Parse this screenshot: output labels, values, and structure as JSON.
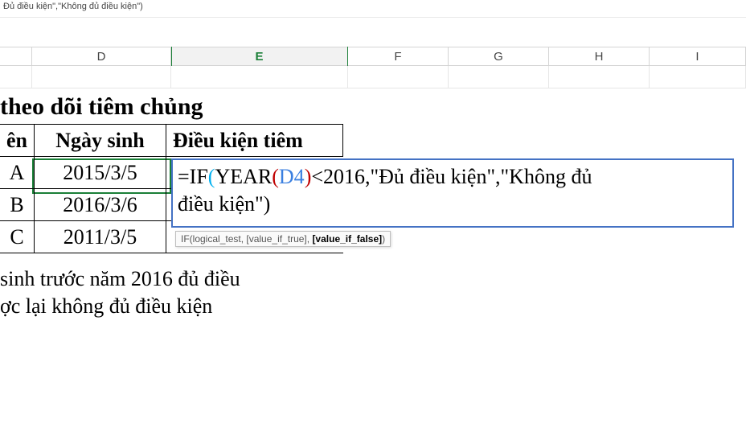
{
  "formula_bar": "Đủ điều kiện\",\"Không đủ điều kiện\")",
  "columns": {
    "D": "D",
    "E": "E",
    "F": "F",
    "G": "G",
    "H": "H",
    "I": "I"
  },
  "table": {
    "title_fragment": "theo dõi tiêm chủng",
    "headers": {
      "ten_suffix": "ên",
      "ngay_sinh": "Ngày sinh",
      "dieu_kien": "Điều kiện tiêm"
    },
    "rows": [
      {
        "ten": "A",
        "ngay_sinh": "2015/3/5"
      },
      {
        "ten": "B",
        "ngay_sinh": "2016/3/6"
      },
      {
        "ten": "C",
        "ngay_sinh": "2011/3/5"
      }
    ]
  },
  "edit": {
    "prefix": "=IF",
    "open1": "(",
    "year": "YEAR",
    "open2": "(",
    "ref": "D4",
    "close2": ")",
    "cond": "<2016,\"Đủ điều kiện\",\"Không đủ",
    "line2": "điều kiện\")"
  },
  "tooltip": {
    "fn": "IF(",
    "arg1": "logical_test",
    "arg2": ", [value_if_true], ",
    "arg3": "[value_if_false]",
    "close": ")"
  },
  "note": {
    "line1": "sinh trước năm 2016 đủ điều",
    "line2": "ợc lại không đủ điều kiện"
  },
  "col_widths": {
    "pre": 40,
    "D": 173,
    "E": 220,
    "F": 125,
    "G": 125,
    "H": 125,
    "I": 120
  }
}
